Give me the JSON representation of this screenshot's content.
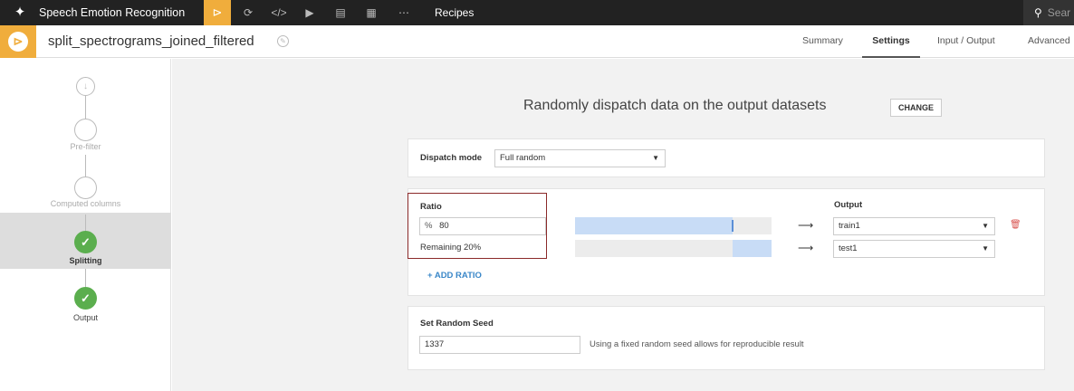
{
  "topbar": {
    "logo_icon": "bird-logo-icon",
    "app_title": "Speech Emotion Recognition",
    "nav_icons": [
      "flow-icon",
      "sync-icon",
      "code-icon",
      "play-icon",
      "database-icon",
      "dashboard-icon",
      "more-icon"
    ],
    "recipes_label": "Recipes",
    "search_placeholder": "Sear",
    "accent": "#f0ad3c"
  },
  "subheader": {
    "recipe_name": "split_spectrograms_joined_filtered",
    "tabs": [
      {
        "label": "Summary",
        "active": false
      },
      {
        "label": "Settings",
        "active": true
      },
      {
        "label": "Input / Output",
        "active": false
      },
      {
        "label": "Advanced",
        "active": false
      }
    ]
  },
  "steps": [
    {
      "label": "Pre-filter",
      "state": "pending"
    },
    {
      "label": "Computed columns",
      "state": "pending"
    },
    {
      "label": "Splitting",
      "state": "done",
      "active": true
    },
    {
      "label": "Output",
      "state": "done"
    }
  ],
  "main": {
    "heading": "Randomly dispatch data on the output datasets",
    "change_label": "CHANGE",
    "dispatch": {
      "label": "Dispatch mode",
      "value": "Full random"
    },
    "ratio": {
      "header": "Ratio",
      "output_header": "Output",
      "rows": [
        {
          "prefix": "%",
          "value": "80",
          "output": "train1",
          "fill_start": 0,
          "fill_end": 0.8
        },
        {
          "text": "Remaining 20%",
          "output": "test1",
          "fill_start": 0.8,
          "fill_end": 1.0
        }
      ],
      "add_label": "+ ADD RATIO",
      "arrow_glyph": "⟶",
      "bar_color": "#c8dcf6"
    },
    "seed": {
      "label": "Set Random Seed",
      "value": "1337",
      "hint": "Using a fixed random seed allows for reproducible result"
    }
  }
}
